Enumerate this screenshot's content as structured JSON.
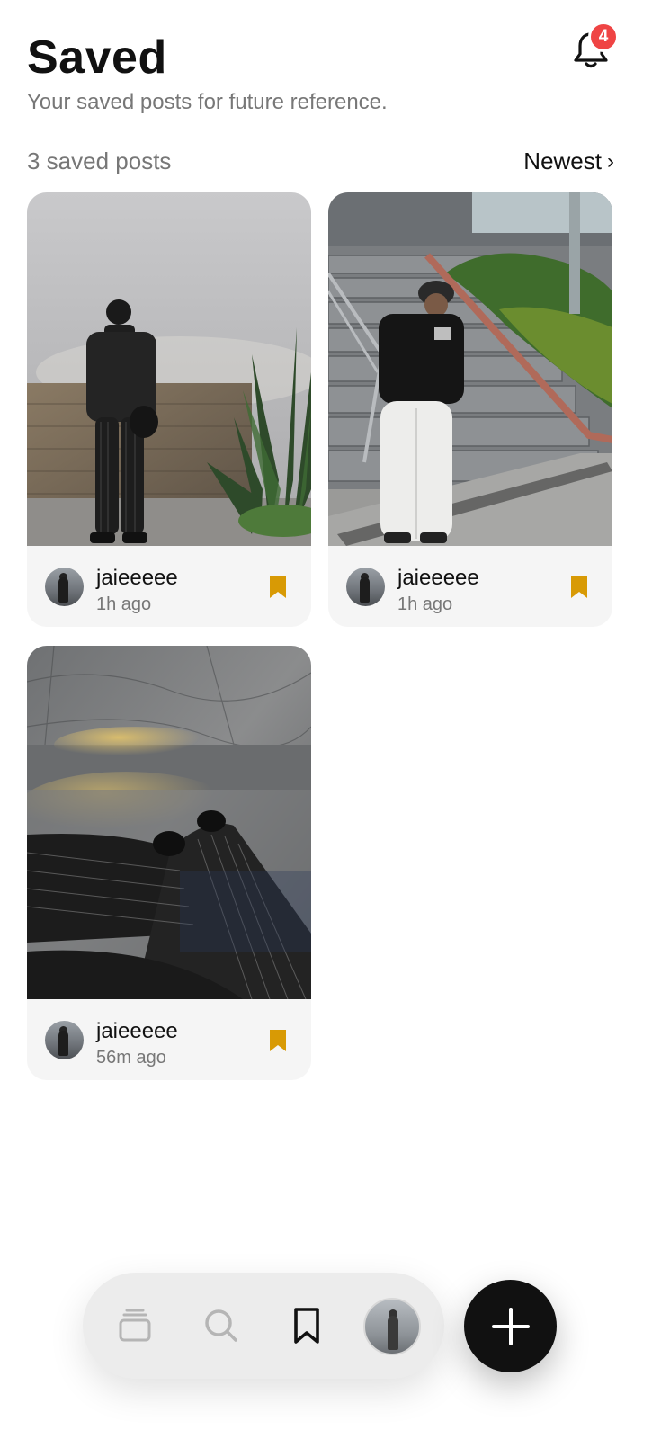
{
  "header": {
    "title": "Saved",
    "subtitle": "Your saved posts for future reference.",
    "notification_count": "4"
  },
  "toolbar": {
    "count_text": "3 saved posts",
    "sort_label": "Newest",
    "sort_chevron": "›"
  },
  "posts": [
    {
      "username": "jaieeeee",
      "time": "1h ago",
      "saved": true,
      "photo": "person in dark outfit by stone wall and plant"
    },
    {
      "username": "jaieeeee",
      "time": "1h ago",
      "saved": true,
      "photo": "person in black tee and white pants on stairs"
    },
    {
      "username": "jaieeeee",
      "time": "56m ago",
      "saved": true,
      "photo": "pinstripe pants and shoes on marble floor"
    }
  ],
  "nav": {
    "items": [
      "feed-icon",
      "search-icon",
      "bookmark-icon",
      "profile-avatar"
    ],
    "active": "bookmark-icon",
    "fab_icon": "plus-icon"
  },
  "colors": {
    "bookmark": "#D89A05",
    "badge": "#EF4444",
    "fab": "#111111",
    "navbar": "#ECECEC"
  }
}
